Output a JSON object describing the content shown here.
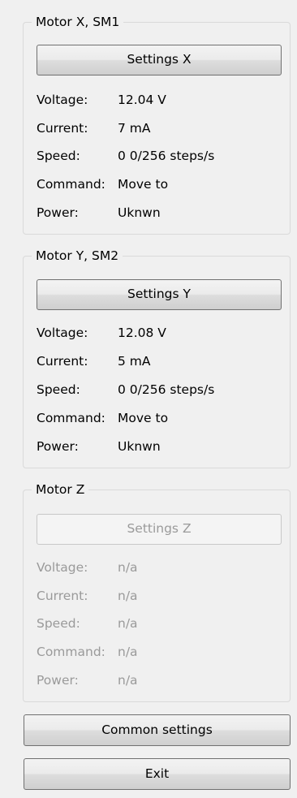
{
  "motor_x": {
    "title": "Motor X, SM1",
    "settings_label": "Settings X",
    "voltage_label": "Voltage:",
    "voltage_value": "12.04 V",
    "current_label": "Current:",
    "current_value": "7 mA",
    "speed_label": "Speed:",
    "speed_value": "0 0/256 steps/s",
    "command_label": "Command:",
    "command_value": "Move to",
    "power_label": "Power:",
    "power_value": "Uknwn"
  },
  "motor_y": {
    "title": "Motor Y, SM2",
    "settings_label": "Settings Y",
    "voltage_label": "Voltage:",
    "voltage_value": "12.08 V",
    "current_label": "Current:",
    "current_value": "5 mA",
    "speed_label": "Speed:",
    "speed_value": "0 0/256 steps/s",
    "command_label": "Command:",
    "command_value": "Move to",
    "power_label": "Power:",
    "power_value": "Uknwn"
  },
  "motor_z": {
    "title": "Motor Z",
    "settings_label": "Settings Z",
    "voltage_label": "Voltage:",
    "voltage_value": "n/a",
    "current_label": "Current:",
    "current_value": "n/a",
    "speed_label": "Speed:",
    "speed_value": "n/a",
    "command_label": "Command:",
    "command_value": "n/a",
    "power_label": "Power:",
    "power_value": "n/a"
  },
  "common_settings_label": "Common settings",
  "exit_label": "Exit",
  "colors": {
    "background": "#f0f0f0",
    "group_border": "#d9d9d9",
    "button_border": "#707070",
    "disabled_text": "#9a9a9a"
  }
}
